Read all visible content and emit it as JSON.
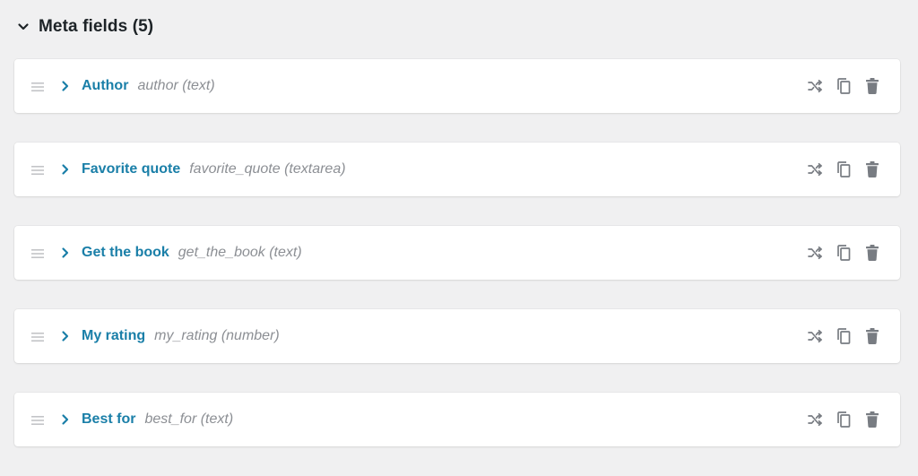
{
  "section": {
    "title": "Meta fields",
    "count": "(5)",
    "collapse_icon": "chevron-down-icon"
  },
  "colors": {
    "background": "#f0f0f1",
    "label": "#1a7fa8",
    "meta": "#8c8f94",
    "icon": "#787c82"
  },
  "fields": [
    {
      "label": "Author",
      "meta": "author (text)"
    },
    {
      "label": "Favorite quote",
      "meta": "favorite_quote (textarea)"
    },
    {
      "label": "Get the book",
      "meta": "get_the_book (text)"
    },
    {
      "label": "My rating",
      "meta": "my_rating (number)"
    },
    {
      "label": "Best for",
      "meta": "best_for (text)"
    }
  ],
  "row_icons": {
    "drag": "drag-handle-icon",
    "expand": "chevron-right-icon",
    "actions": [
      "shuffle-icon",
      "copy-icon",
      "trash-icon"
    ]
  }
}
